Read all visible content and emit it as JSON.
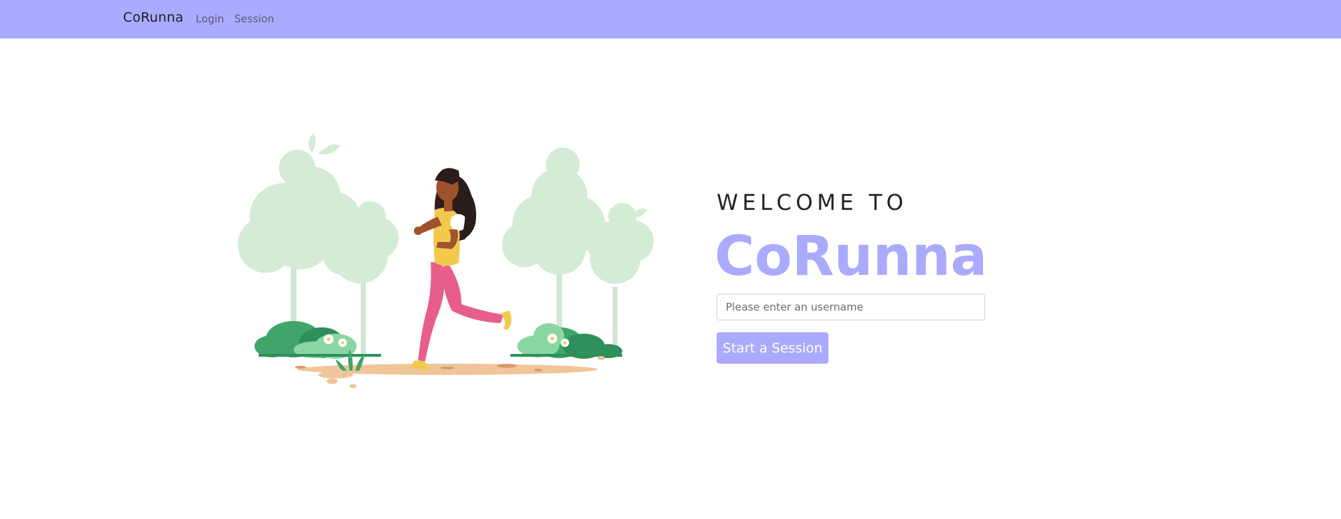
{
  "navbar": {
    "brand": "CoRunna",
    "links": [
      {
        "label": "Login"
      },
      {
        "label": "Session"
      }
    ],
    "background_color": "#aaaafe"
  },
  "hero": {
    "welcome_text": "WELCOME TO",
    "title": "CoRunna",
    "title_color": "#aaaafe",
    "username_input": {
      "value": "",
      "placeholder": "Please enter an username"
    },
    "start_button_label": "Start a Session",
    "illustration": "woman-running-in-park-illustration"
  }
}
